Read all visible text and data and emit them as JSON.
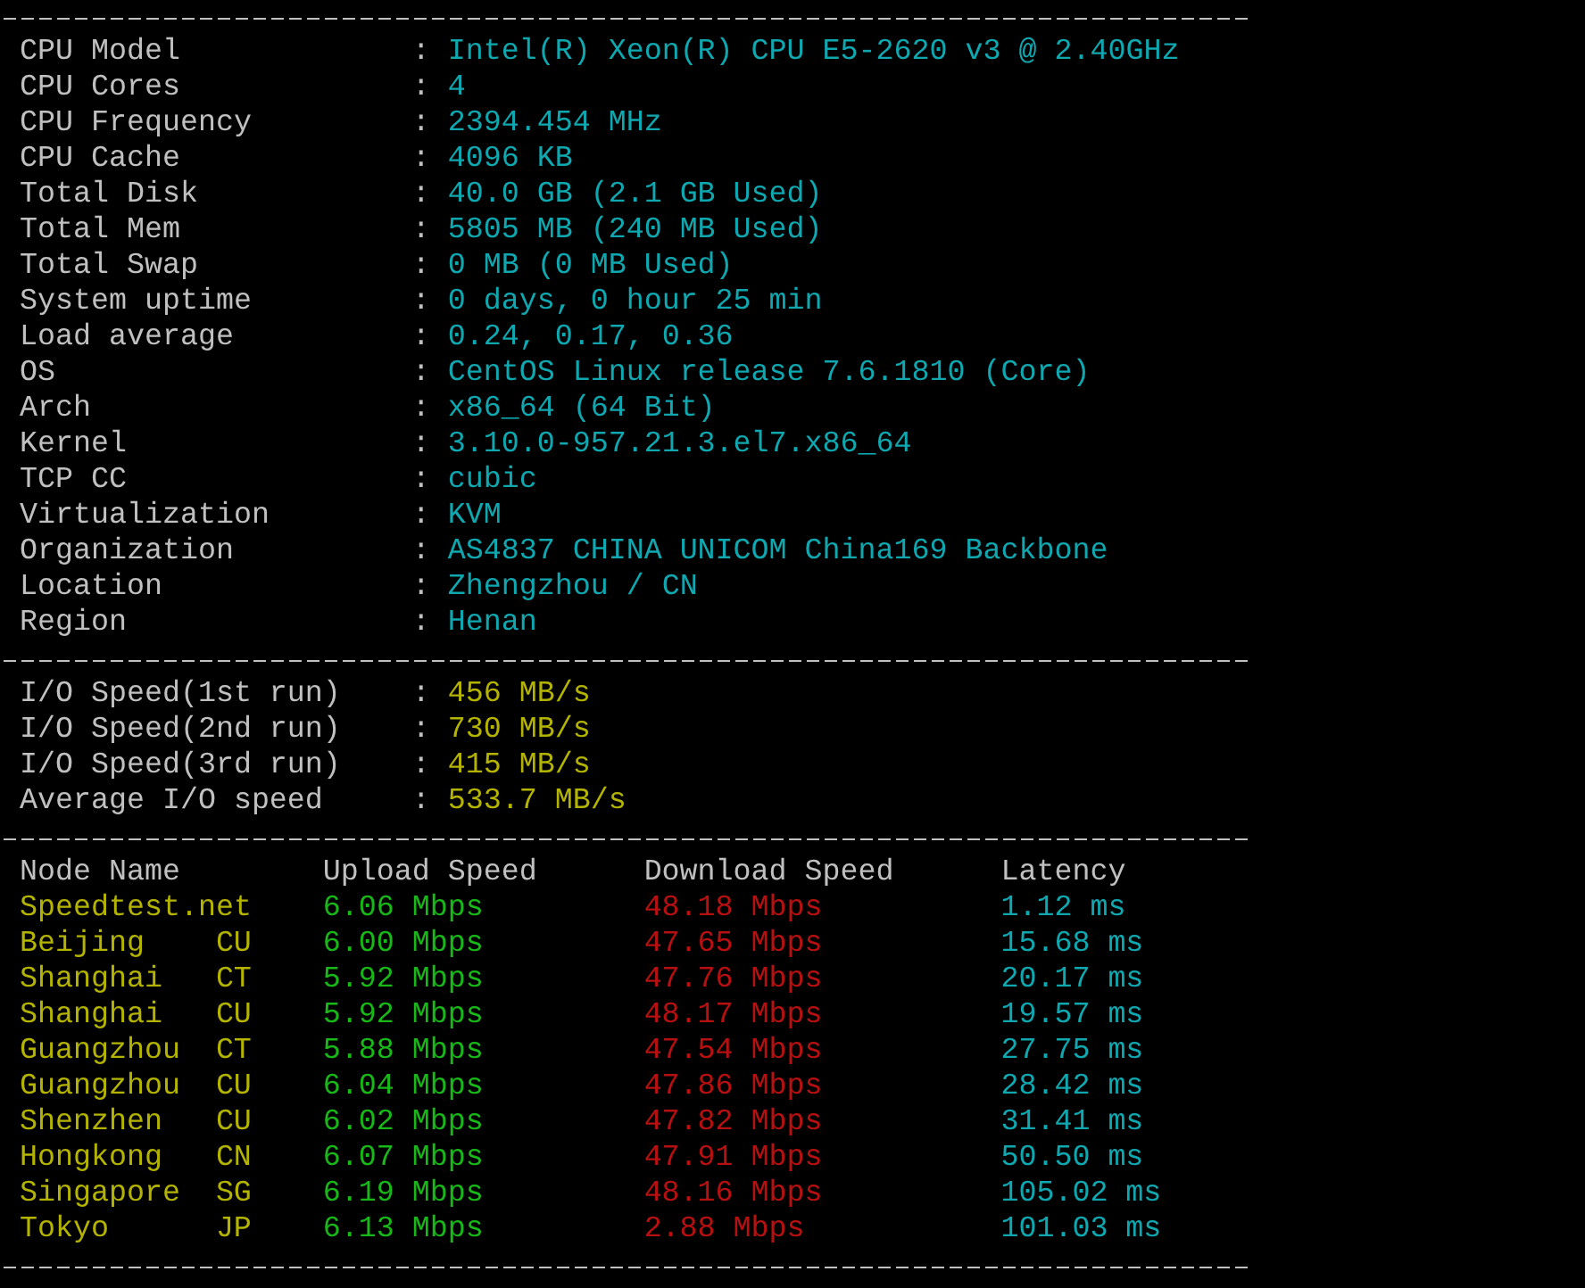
{
  "system_info": [
    {
      "label": "CPU Model",
      "separator": ":",
      "value": "Intel(R) Xeon(R) CPU E5-2620 v3 @ 2.40GHz"
    },
    {
      "label": "CPU Cores",
      "separator": ":",
      "value": "4"
    },
    {
      "label": "CPU Frequency",
      "separator": ":",
      "value": "2394.454 MHz"
    },
    {
      "label": "CPU Cache",
      "separator": ":",
      "value": "4096 KB"
    },
    {
      "label": "Total Disk",
      "separator": ":",
      "value": "40.0 GB (2.1 GB Used)"
    },
    {
      "label": "Total Mem",
      "separator": ":",
      "value": "5805 MB (240 MB Used)"
    },
    {
      "label": "Total Swap",
      "separator": ":",
      "value": "0 MB (0 MB Used)"
    },
    {
      "label": "System uptime",
      "separator": ":",
      "value": "0 days, 0 hour 25 min"
    },
    {
      "label": "Load average",
      "separator": ":",
      "value": "0.24, 0.17, 0.36"
    },
    {
      "label": "OS",
      "separator": ":",
      "value": "CentOS Linux release 7.6.1810 (Core)"
    },
    {
      "label": "Arch",
      "separator": ":",
      "value": "x86_64 (64 Bit)"
    },
    {
      "label": "Kernel",
      "separator": ":",
      "value": "3.10.0-957.21.3.el7.x86_64"
    },
    {
      "label": "TCP CC",
      "separator": ":",
      "value": "cubic"
    },
    {
      "label": "Virtualization",
      "separator": ":",
      "value": "KVM"
    },
    {
      "label": "Organization",
      "separator": ":",
      "value": "AS4837 CHINA UNICOM China169 Backbone"
    },
    {
      "label": "Location",
      "separator": ":",
      "value": "Zhengzhou / CN"
    },
    {
      "label": "Region",
      "separator": ":",
      "value": "Henan"
    }
  ],
  "io_speed": [
    {
      "label": "I/O Speed(1st run)",
      "separator": ":",
      "value": "456 MB/s"
    },
    {
      "label": "I/O Speed(2nd run)",
      "separator": ":",
      "value": "730 MB/s"
    },
    {
      "label": "I/O Speed(3rd run)",
      "separator": ":",
      "value": "415 MB/s"
    },
    {
      "label": "Average I/O speed",
      "separator": ":",
      "value": "533.7 MB/s"
    }
  ],
  "speed_table": {
    "columns": [
      "Node Name",
      "Upload Speed",
      "Download Speed",
      "Latency"
    ],
    "rows": [
      {
        "node": "Speedtest.net",
        "upload": "6.06 Mbps",
        "download": "48.18 Mbps",
        "latency": "1.12 ms"
      },
      {
        "node": "Beijing",
        "isp": "CU",
        "upload": "6.00 Mbps",
        "download": "47.65 Mbps",
        "latency": "15.68 ms"
      },
      {
        "node": "Shanghai",
        "isp": "CT",
        "upload": "5.92 Mbps",
        "download": "47.76 Mbps",
        "latency": "20.17 ms"
      },
      {
        "node": "Shanghai",
        "isp": "CU",
        "upload": "5.92 Mbps",
        "download": "48.17 Mbps",
        "latency": "19.57 ms"
      },
      {
        "node": "Guangzhou",
        "isp": "CT",
        "upload": "5.88 Mbps",
        "download": "47.54 Mbps",
        "latency": "27.75 ms"
      },
      {
        "node": "Guangzhou",
        "isp": "CU",
        "upload": "6.04 Mbps",
        "download": "47.86 Mbps",
        "latency": "28.42 ms"
      },
      {
        "node": "Shenzhen",
        "isp": "CU",
        "upload": "6.02 Mbps",
        "download": "47.82 Mbps",
        "latency": "31.41 ms"
      },
      {
        "node": "Hongkong",
        "isp": "CN",
        "upload": "6.07 Mbps",
        "download": "47.91 Mbps",
        "latency": "50.50 ms"
      },
      {
        "node": "Singapore",
        "isp": "SG",
        "upload": "6.19 Mbps",
        "download": "48.16 Mbps",
        "latency": "105.02 ms"
      },
      {
        "node": "Tokyo",
        "isp": "JP",
        "upload": "6.13 Mbps",
        "download": "2.88 Mbps",
        "latency": "101.03 ms"
      }
    ]
  }
}
